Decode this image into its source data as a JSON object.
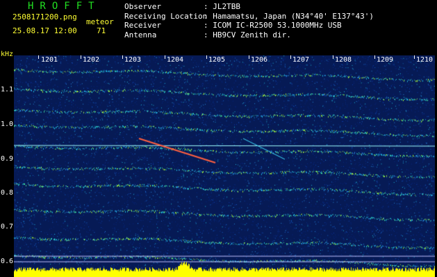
{
  "header": {
    "app_title": "HROFFT",
    "filename": "2508171200.png",
    "meteor_label": "meteor",
    "datetime": "25.08.17 12:00",
    "meteor_count": "71"
  },
  "info": [
    {
      "key": "Observer",
      "value": ": JL2TBB"
    },
    {
      "key": "Receiving Location",
      "value": ": Hamamatsu, Japan (N34°40' E137°43')"
    },
    {
      "key": "Receiver",
      "value": ": ICOM IC-R2500 53.1000MHz USB"
    },
    {
      "key": "Antenna",
      "value": ": HB9CV Zenith dir."
    }
  ],
  "axis": {
    "unit": "kHz",
    "y_ticks": [
      "1.1",
      "1.0",
      "0.9",
      "0.8",
      "0.7",
      "0.6"
    ],
    "x_ticks": [
      "1201",
      "1202",
      "1203",
      "1204",
      "1205",
      "1206",
      "1207",
      "1208",
      "1209",
      "1210"
    ]
  },
  "colors": {
    "background": "#000000",
    "spectrogram_bg": "#061a55",
    "title_green": "#22e022",
    "label_yellow": "#ffff33",
    "trace_yellow": "#ffff00"
  }
}
